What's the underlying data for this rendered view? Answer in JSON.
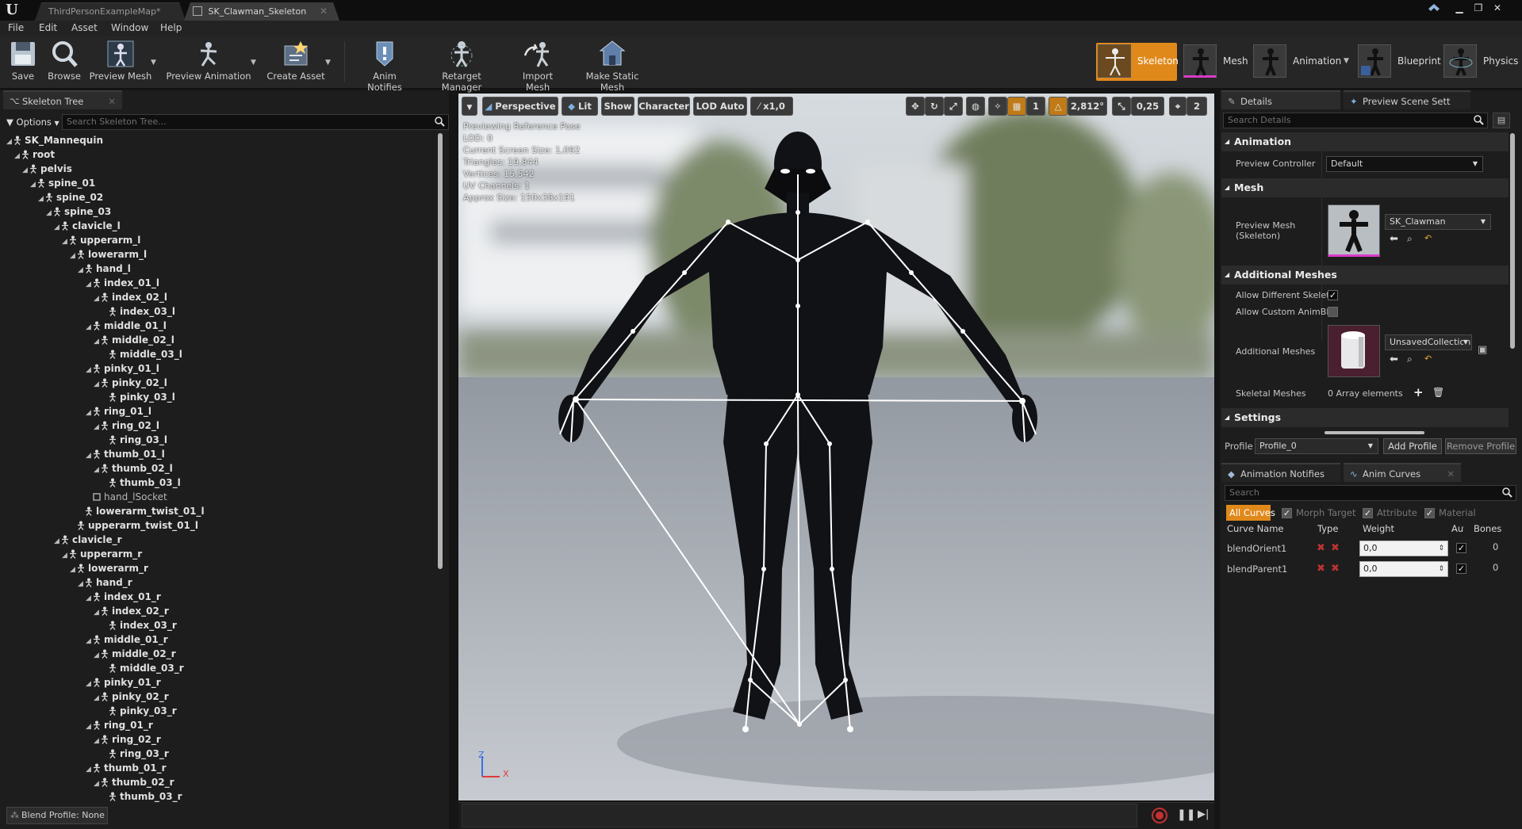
{
  "window": {
    "tabs": [
      {
        "label": "ThirdPersonExampleMap*"
      },
      {
        "label": "SK_Clawman_Skeleton"
      }
    ]
  },
  "menu": [
    "File",
    "Edit",
    "Asset",
    "Window",
    "Help"
  ],
  "toolbar": {
    "save": "Save",
    "browse": "Browse",
    "preview_mesh": "Preview Mesh",
    "preview_animation": "Preview Animation",
    "create_asset": "Create Asset",
    "anim_notifies": "Anim Notifies",
    "retarget_manager": "Retarget Manager",
    "import_mesh": "Import Mesh",
    "make_static_mesh": "Make Static Mesh"
  },
  "modes": {
    "skeleton": "Skeleton",
    "mesh": "Mesh",
    "animation": "Animation",
    "blueprint": "Blueprint",
    "physics": "Physics"
  },
  "skeleton_tree": {
    "tab": "Skeleton Tree",
    "options": "Options",
    "search_placeholder": "Search Skeleton Tree...",
    "rows": [
      {
        "label": "SK_Mannequin",
        "depth": 0
      },
      {
        "label": "root",
        "depth": 1
      },
      {
        "label": "pelvis",
        "depth": 2
      },
      {
        "label": "spine_01",
        "depth": 3
      },
      {
        "label": "spine_02",
        "depth": 4
      },
      {
        "label": "spine_03",
        "depth": 5
      },
      {
        "label": "clavicle_l",
        "depth": 6
      },
      {
        "label": "upperarm_l",
        "depth": 7
      },
      {
        "label": "lowerarm_l",
        "depth": 8
      },
      {
        "label": "hand_l",
        "depth": 9
      },
      {
        "label": "index_01_l",
        "depth": 10
      },
      {
        "label": "index_02_l",
        "depth": 11
      },
      {
        "label": "index_03_l",
        "depth": 12
      },
      {
        "label": "middle_01_l",
        "depth": 10
      },
      {
        "label": "middle_02_l",
        "depth": 11
      },
      {
        "label": "middle_03_l",
        "depth": 12
      },
      {
        "label": "pinky_01_l",
        "depth": 10
      },
      {
        "label": "pinky_02_l",
        "depth": 11
      },
      {
        "label": "pinky_03_l",
        "depth": 12
      },
      {
        "label": "ring_01_l",
        "depth": 10
      },
      {
        "label": "ring_02_l",
        "depth": 11
      },
      {
        "label": "ring_03_l",
        "depth": 12
      },
      {
        "label": "thumb_01_l",
        "depth": 10
      },
      {
        "label": "thumb_02_l",
        "depth": 11
      },
      {
        "label": "thumb_03_l",
        "depth": 12
      },
      {
        "label": "hand_lSocket",
        "depth": 10,
        "socket": true
      },
      {
        "label": "lowerarm_twist_01_l",
        "depth": 9
      },
      {
        "label": "upperarm_twist_01_l",
        "depth": 8
      },
      {
        "label": "clavicle_r",
        "depth": 6
      },
      {
        "label": "upperarm_r",
        "depth": 7
      },
      {
        "label": "lowerarm_r",
        "depth": 8
      },
      {
        "label": "hand_r",
        "depth": 9
      },
      {
        "label": "index_01_r",
        "depth": 10
      },
      {
        "label": "index_02_r",
        "depth": 11
      },
      {
        "label": "index_03_r",
        "depth": 12
      },
      {
        "label": "middle_01_r",
        "depth": 10
      },
      {
        "label": "middle_02_r",
        "depth": 11
      },
      {
        "label": "middle_03_r",
        "depth": 12
      },
      {
        "label": "pinky_01_r",
        "depth": 10
      },
      {
        "label": "pinky_02_r",
        "depth": 11
      },
      {
        "label": "pinky_03_r",
        "depth": 12
      },
      {
        "label": "ring_01_r",
        "depth": 10
      },
      {
        "label": "ring_02_r",
        "depth": 11
      },
      {
        "label": "ring_03_r",
        "depth": 12
      },
      {
        "label": "thumb_01_r",
        "depth": 10
      },
      {
        "label": "thumb_02_r",
        "depth": 11
      },
      {
        "label": "thumb_03_r",
        "depth": 12
      }
    ],
    "blend_profile": "Blend Profile: None"
  },
  "viewport": {
    "perspective": "Perspective",
    "lit": "Lit",
    "show": "Show",
    "character": "Character",
    "lod": "LOD Auto",
    "speed": "x1,0",
    "grid_value": "1",
    "rotate_value": "2,812°",
    "scale_value": "0,25",
    "camera_speed": "2",
    "stats": [
      "Previewing Reference Pose",
      "LOD: 0",
      "Current Screen Size: 1,092",
      "Triangles: 19,844",
      "Vertices: 15,542",
      "UV Channels: 1",
      "Approx Size: 150x38x191"
    ],
    "axis_z": "Z",
    "axis_x": "X"
  },
  "details": {
    "tab": "Details",
    "tab2": "Preview Scene Sett",
    "search_placeholder": "Search Details",
    "animation_header": "Animation",
    "preview_controller_label": "Preview Controller",
    "preview_controller_value": "Default",
    "mesh_header": "Mesh",
    "preview_mesh_label": "Preview Mesh (Skeleton)",
    "preview_mesh_value": "SK_Clawman",
    "additional_meshes_header": "Additional Meshes",
    "allow_different_label": "Allow Different Skelet",
    "allow_different_checked": true,
    "allow_custom_label": "Allow Custom AnimBl",
    "allow_custom_checked": false,
    "additional_meshes_label": "Additional Meshes",
    "additional_meshes_value": "UnsavedCollection",
    "skeletal_meshes_label": "Skeletal Meshes",
    "skeletal_meshes_value": "0 Array elements",
    "settings_header": "Settings",
    "profile_label": "Profile",
    "profile_value": "Profile_0",
    "add_profile": "Add Profile",
    "remove_profile": "Remove Profile"
  },
  "anim_panel": {
    "tab_notifies": "Animation Notifies",
    "tab_curves": "Anim Curves",
    "search_placeholder": "Search",
    "filters": [
      "All Curves",
      "Morph Target",
      "Attribute",
      "Material"
    ],
    "columns": [
      "Curve Name",
      "Type",
      "Weight",
      "Auto",
      "Bones"
    ],
    "rows": [
      {
        "name": "blendOrient1",
        "weight": "0,0",
        "auto": true,
        "bones": "0"
      },
      {
        "name": "blendParent1",
        "weight": "0,0",
        "auto": true,
        "bones": "0"
      }
    ]
  },
  "colors": {
    "accent": "#e0891b",
    "panel_bg": "#1d1d1d",
    "header_bg": "#2b2b2b"
  }
}
